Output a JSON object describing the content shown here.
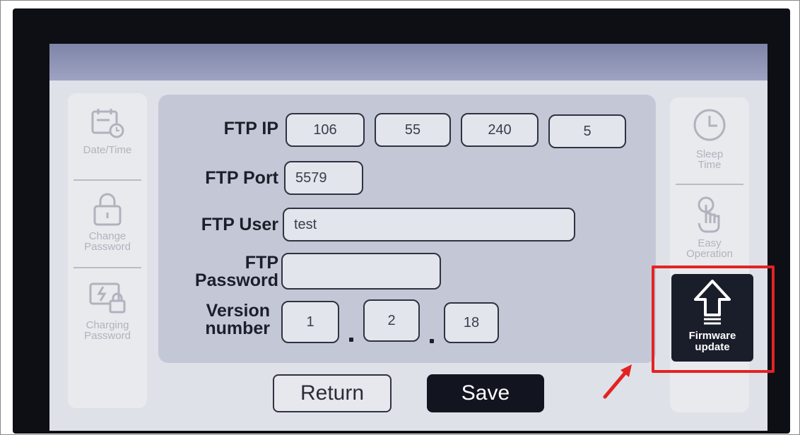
{
  "sidebar_left": {
    "items": [
      {
        "icon": "calendar-clock-icon",
        "label": "Date/Time"
      },
      {
        "icon": "lock-icon",
        "label_line1": "Change",
        "label_line2": "Password"
      },
      {
        "icon": "charging-lock-icon",
        "label_line1": "Charging",
        "label_line2": "Password"
      }
    ]
  },
  "sidebar_right": {
    "items": [
      {
        "icon": "clock-icon",
        "label_line1": "Sleep",
        "label_line2": "Time"
      },
      {
        "icon": "hand-tap-icon",
        "label_line1": "Easy",
        "label_line2": "Operation"
      },
      {
        "icon": "upload-arrow-icon",
        "label_line1": "Firmware",
        "label_line2": "update",
        "selected": true
      }
    ]
  },
  "form": {
    "ftp_ip": {
      "label": "FTP IP",
      "octets": [
        "106",
        "55",
        "240",
        "5"
      ]
    },
    "ftp_port": {
      "label": "FTP Port",
      "value": "5579"
    },
    "ftp_user": {
      "label": "FTP User",
      "value": "test"
    },
    "ftp_password": {
      "label_line1": "FTP",
      "label_line2": "Password",
      "value": ""
    },
    "version": {
      "label_line1": "Version",
      "label_line2": "number",
      "parts": [
        "1",
        "2",
        "18"
      ]
    }
  },
  "buttons": {
    "return_label": "Return",
    "save_label": "Save"
  },
  "colors": {
    "highlight": "#e32323",
    "save_bg": "#121420",
    "panel_bg": "#c4c8d6"
  }
}
